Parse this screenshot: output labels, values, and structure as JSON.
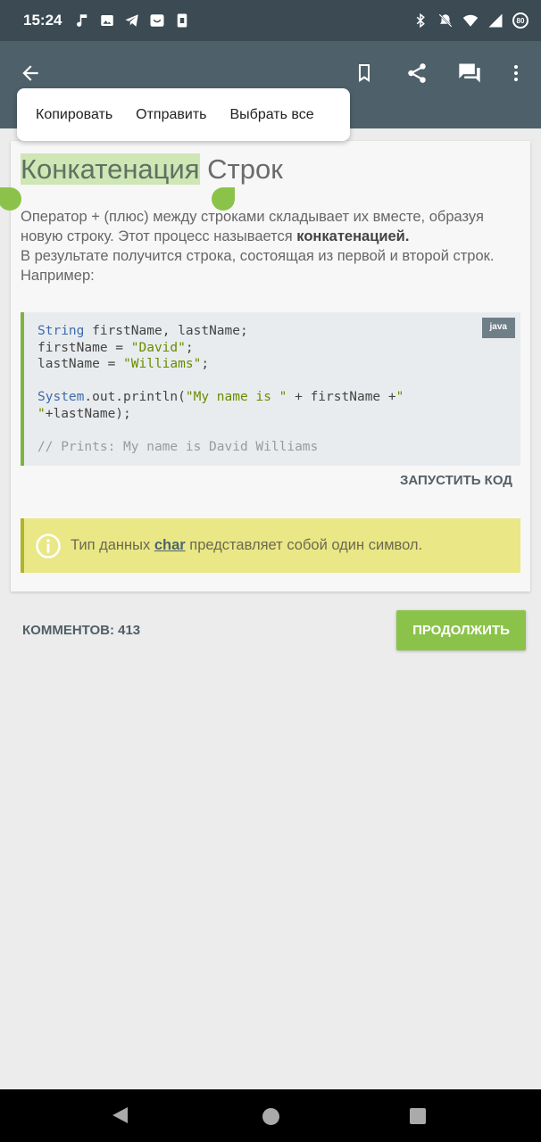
{
  "status_bar": {
    "time": "15:24",
    "left_icons": [
      "music-icon",
      "image-icon",
      "telegram-icon",
      "smile-icon",
      "sim-icon"
    ],
    "right_icons": [
      "bluetooth-icon",
      "mute-icon",
      "wifi-icon",
      "signal-icon"
    ],
    "battery": "80"
  },
  "app_bar": {
    "icons": [
      "back-arrow-icon",
      "bookmark-icon",
      "share-icon",
      "comments-icon",
      "more-vert-icon"
    ]
  },
  "context_menu": {
    "copy": "Копировать",
    "send": "Отправить",
    "select_all": "Выбрать все"
  },
  "lesson": {
    "title_selected": "Конкатенация",
    "title_rest": " Строк",
    "body_part1": "Оператор + (плюс) между строками складывает их вместе, образуя новую строку. Этот процесс называется ",
    "body_bold": "конкатенацией.",
    "body_part2": "В результате получится строка, состоящая из первой и второй строк.",
    "body_part3": "Например:",
    "code": {
      "lang": "java",
      "l1_kw": "String",
      "l1_rest": " firstName, lastName;",
      "l2_pre": "firstName = ",
      "l2_str": "\"David\"",
      "l2_end": ";",
      "l3_pre": "lastName = ",
      "l3_str": "\"Williams\"",
      "l3_end": ";",
      "l5_kw": "System",
      "l5_a": ".out.println(",
      "l5_str": "\"My name is \"",
      "l5_b": " + firstName +",
      "l5_str2": "\"",
      "l6_str": "\"",
      "l6_rest": "+lastName);",
      "l8_comment": "// Prints: My name is David Williams"
    },
    "run_code": "ЗАПУСТИТЬ КОД",
    "tip_pre": "Тип данных ",
    "tip_link": "char",
    "tip_post": " представляет собой один символ."
  },
  "footer": {
    "comments": "КОММЕНТОВ: 413",
    "continue": "ПРОДОЛЖИТЬ"
  },
  "colors": {
    "status_bar": "#3b4a53",
    "app_bar": "#4e6069",
    "accent_green": "#8bc34a",
    "tip_bg": "#eae786",
    "selection": "#cfe6b5"
  }
}
